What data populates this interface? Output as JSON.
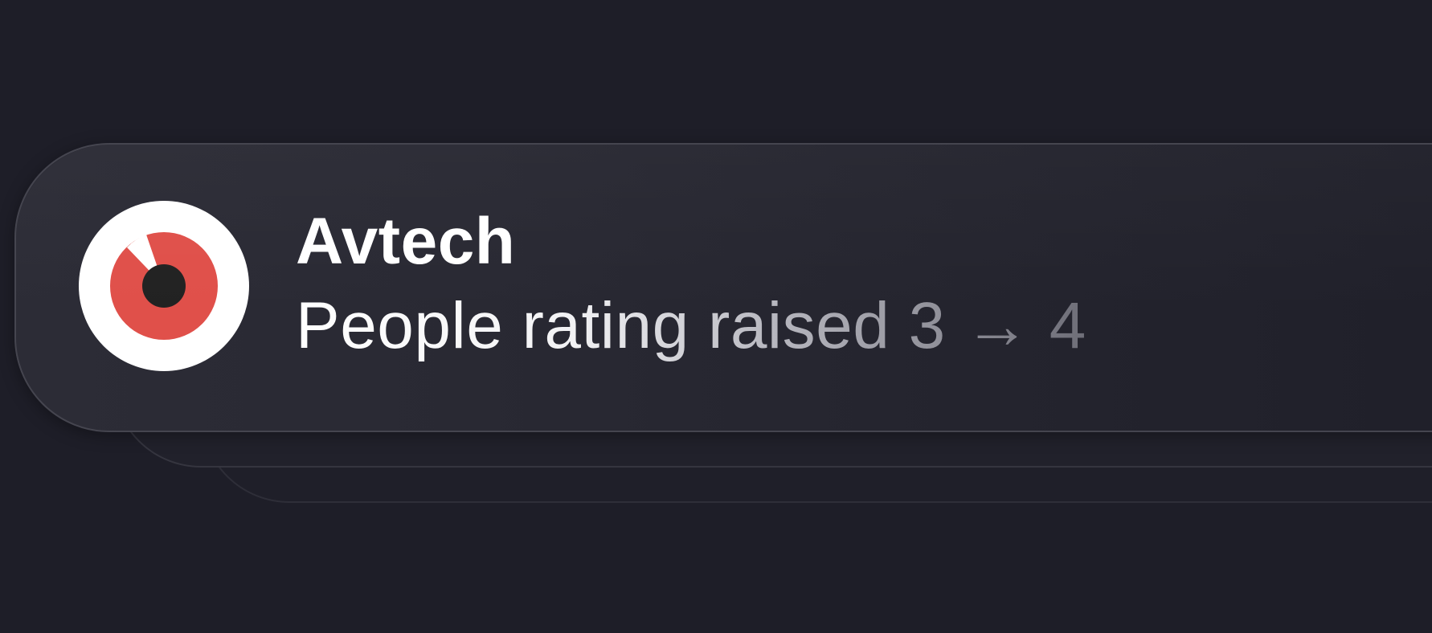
{
  "notification": {
    "app_name": "Avtech",
    "message": "People rating raised 3 → 4",
    "icon": "target-eye-logo-icon"
  },
  "colors": {
    "background": "#1e1e28",
    "card": "#2a2a34",
    "logo_red": "#e0504a",
    "logo_center": "#222222",
    "text_primary": "#ffffff"
  }
}
